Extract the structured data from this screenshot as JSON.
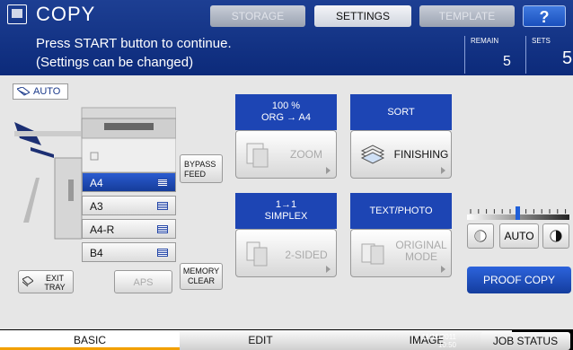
{
  "app": {
    "title": "COPY"
  },
  "top_buttons": {
    "storage": "STORAGE",
    "settings": "SETTINGS",
    "template": "TEMPLATE",
    "help": "?"
  },
  "message": {
    "line1": "Press START button to continue.",
    "line2": "(Settings can be changed)"
  },
  "counters": {
    "remain_label": "REMAIN",
    "remain_value": "5",
    "sets_label": "SETS",
    "sets_value": "5"
  },
  "paper": {
    "auto_label": "AUTO",
    "trays": [
      {
        "label": "A4",
        "selected": true
      },
      {
        "label": "A3",
        "selected": false
      },
      {
        "label": "A4-R",
        "selected": false
      },
      {
        "label": "B4",
        "selected": false
      }
    ],
    "bypass_line1": "BYPASS",
    "bypass_line2": "FEED",
    "exit_tray_line1": "EXIT",
    "exit_tray_line2": "TRAY",
    "aps": "APS",
    "memory_clear_line1": "MEMORY",
    "memory_clear_line2": "CLEAR"
  },
  "functions": {
    "zoom": {
      "head_line1": "100 %",
      "head_line2": "ORG  →  A4",
      "button": "ZOOM"
    },
    "finishing": {
      "head": "SORT",
      "button": "FINISHING"
    },
    "duplex": {
      "head_line1": "1→1",
      "head_line2": "SIMPLEX",
      "button": "2-SIDED"
    },
    "original": {
      "head": "TEXT/PHOTO",
      "button_line1": "ORIGINAL",
      "button_line2": "MODE"
    }
  },
  "density": {
    "auto": "AUTO",
    "level": 0.5
  },
  "proof_copy": "PROOF COPY",
  "tabs": {
    "basic": "BASIC",
    "edit": "EDIT",
    "image": "IMAGE"
  },
  "status": {
    "date": "11/11/2011",
    "time": "10:50",
    "job_status": "JOB STATUS"
  },
  "colors": {
    "header_blue": "#1d45b4",
    "accent_orange": "#f2a000"
  }
}
